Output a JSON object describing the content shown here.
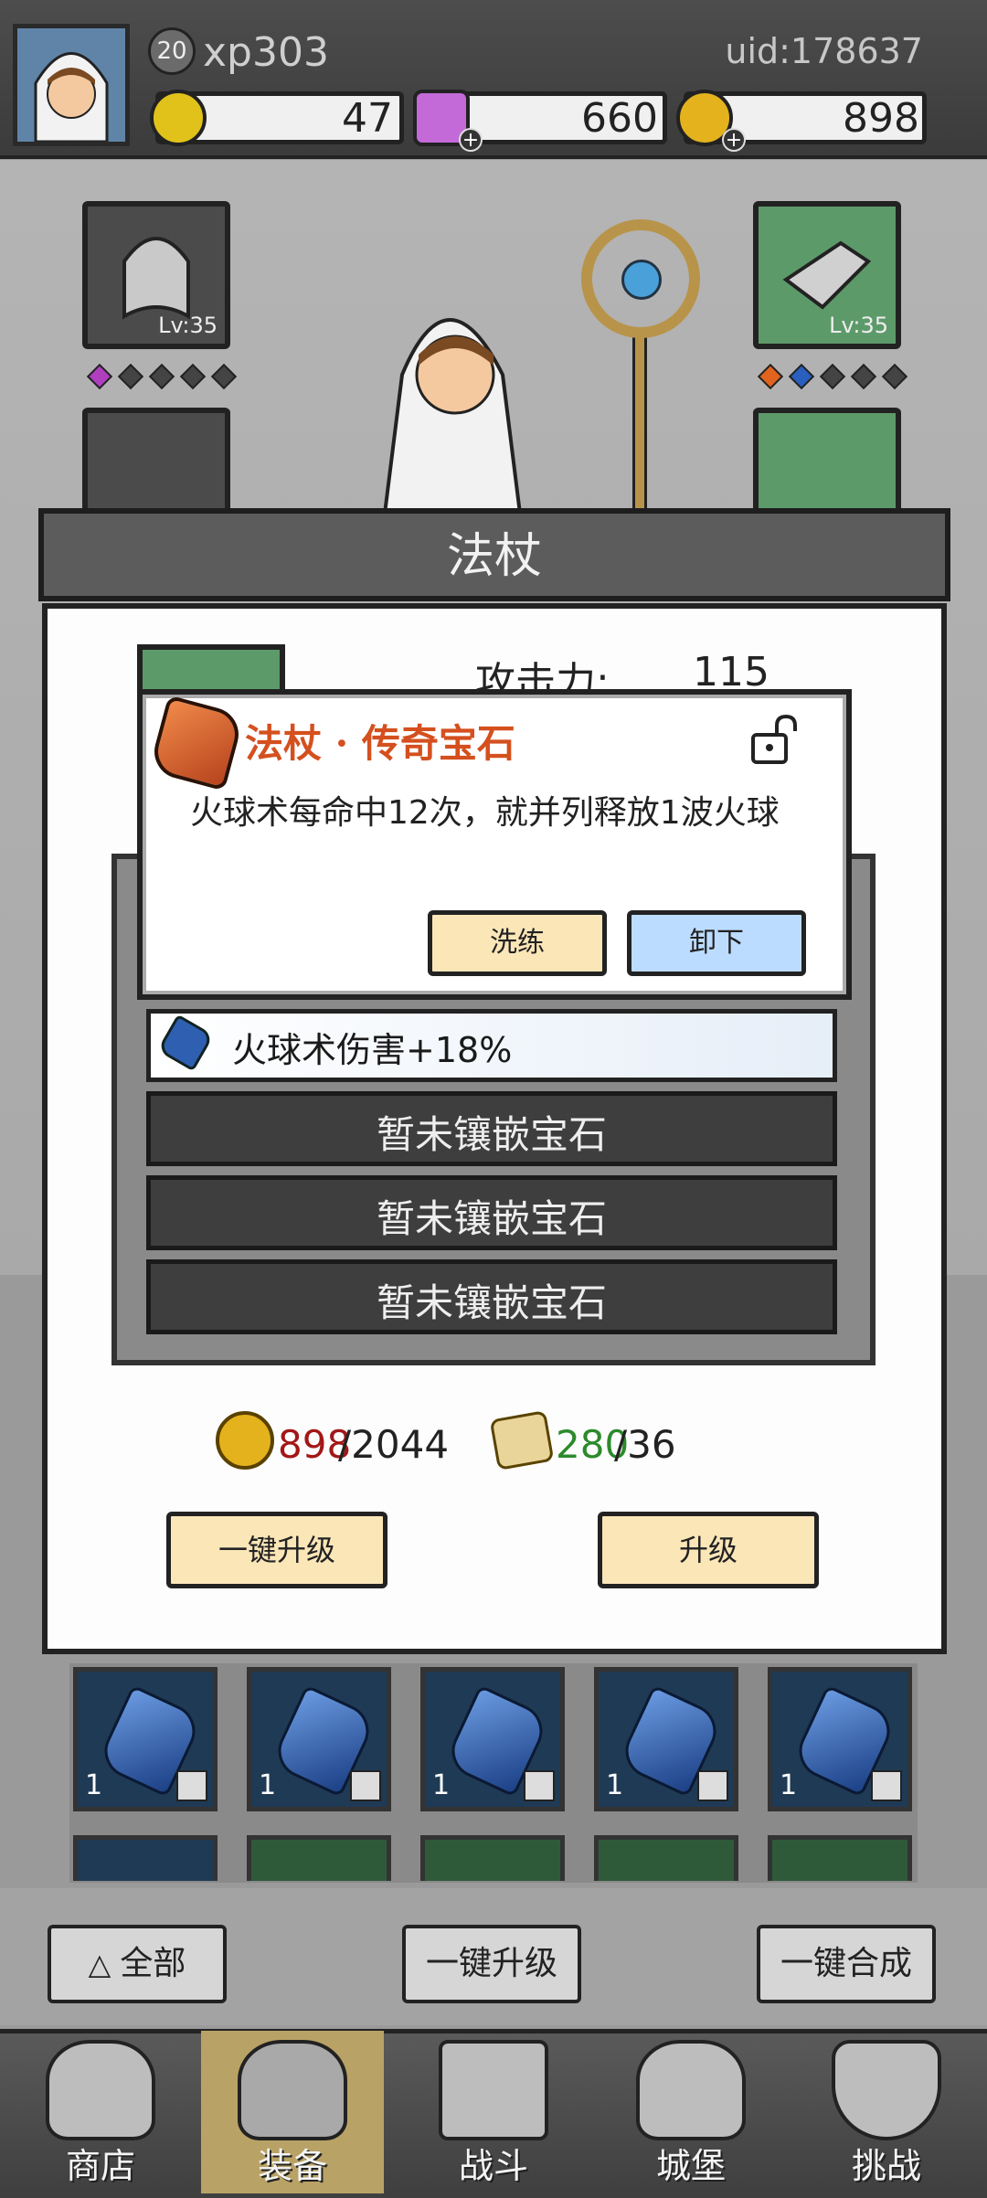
{
  "player": {
    "level": "20",
    "name": "xp303",
    "uid": "uid:178637"
  },
  "resources": {
    "coin": "47",
    "gem": "660",
    "gold": "898"
  },
  "equipment_slots": {
    "hood_level": "Lv:35",
    "glove_level": "Lv:35"
  },
  "panel": {
    "title": "法杖",
    "attack_label": "攻击力:",
    "attack_value": "115"
  },
  "gem_popup": {
    "title": "法杖 · 传奇宝石",
    "description": "火球术每命中12次，就并列释放1波火球",
    "refine_label": "洗练",
    "remove_label": "卸下"
  },
  "sockets": {
    "active_text": "火球术伤害+18%",
    "empty_text": "暂未镶嵌宝石"
  },
  "costs": {
    "gold_have": "898",
    "gold_need": "/2044",
    "scroll_have": "280",
    "scroll_need": "/36"
  },
  "panel_buttons": {
    "one_click_upgrade": "一键升级",
    "upgrade": "升级"
  },
  "inventory": {
    "counts": [
      "1",
      "1",
      "1",
      "1",
      "1"
    ]
  },
  "actions": {
    "filter_all": "全部",
    "one_click_upgrade": "一键升级",
    "one_click_merge": "一键合成"
  },
  "nav": {
    "shop": "商店",
    "equip": "装备",
    "battle": "战斗",
    "castle": "城堡",
    "challenge": "挑战"
  },
  "colors": {
    "legendary_title": "#d4501e",
    "insufficient": "#a31717",
    "sufficient": "#2c8a2c"
  }
}
